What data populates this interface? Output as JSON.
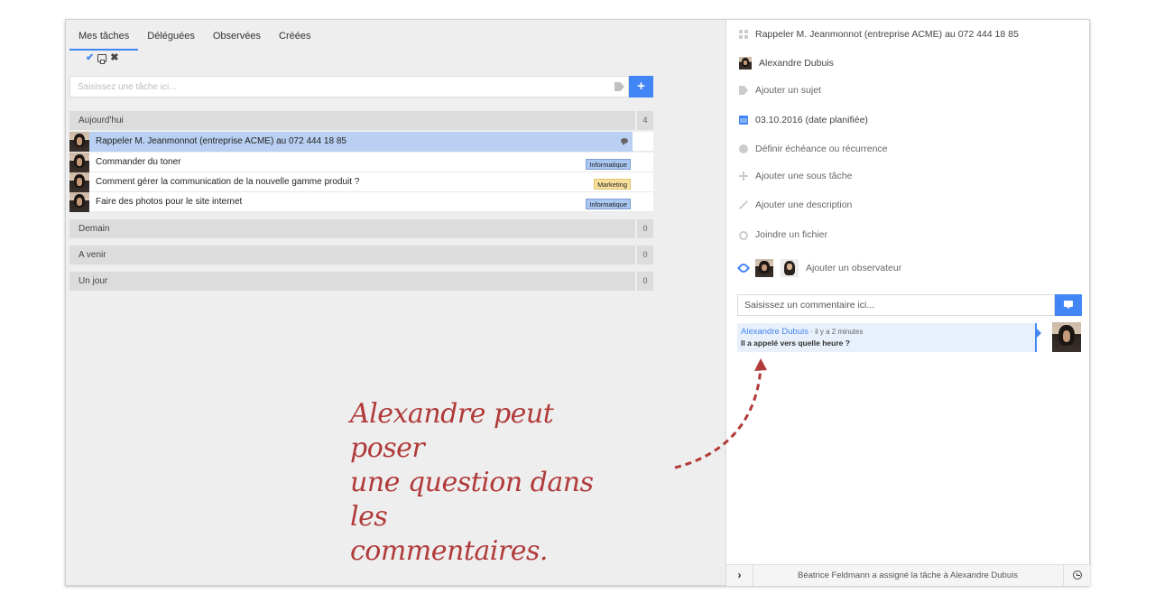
{
  "tabs": [
    "Mes tâches",
    "Déléguées",
    "Observées",
    "Créées"
  ],
  "toolbar": {
    "check_icon": "check-icon",
    "print_icon": "printer-icon",
    "close_icon": "close-icon"
  },
  "task_input": {
    "placeholder": "Saisissez une tâche ici...",
    "add_label": "+"
  },
  "sections": [
    {
      "label": "Aujourd'hui",
      "count": "4"
    },
    {
      "label": "Demain",
      "count": "0"
    },
    {
      "label": "A venir",
      "count": "0"
    },
    {
      "label": "Un jour",
      "count": "0"
    }
  ],
  "tasks": [
    {
      "title": "Rappeler M. Jeanmonnot (entreprise ACME) au 072 444 18 85",
      "priority_color": "#d0d0d0",
      "tag": "",
      "has_comment": true,
      "selected": true
    },
    {
      "title": "Commander du toner",
      "priority_color": "#dd3b2b",
      "tag": "Informatique",
      "tag_color": "#a9c7f0"
    },
    {
      "title": "Comment gérer la communication de la nouvelle gamme produit ?",
      "priority_color": "#dd3b2b",
      "tag": "Marketing",
      "tag_color": "#f9e19c"
    },
    {
      "title": "Faire des photos pour le site internet",
      "priority_color": "#4caf50",
      "tag": "Informatique",
      "tag_color": "#a9c7f0"
    }
  ],
  "annotation": {
    "lines": [
      "Alexandre peut poser",
      "une question dans les",
      "commentaires."
    ],
    "color": "#b13a3a"
  },
  "detail": {
    "title": "Rappeler M. Jeanmonnot (entreprise ACME) au 072 444 18 85",
    "assignee": "Alexandre Dubuis",
    "add_subject": "Ajouter un sujet",
    "date": "03.10.2016 (date planifiée)",
    "deadline": "Définir échéance ou récurrence",
    "add_subtask": "Ajouter une sous tâche",
    "add_description": "Ajouter une description",
    "attach_file": "Joindre un fichier",
    "add_observer": "Ajouter un observateur",
    "comment_placeholder": "Saisissez un commentaire ici...",
    "comment": {
      "author": "Alexandre Dubuis",
      "time": " · il y a 2 minutes",
      "text": "Il a appelé vers quelle heure ?"
    },
    "footer": {
      "expand": "›",
      "activity": "Béatrice Feldmann a assigné la tâche à Alexandre Dubuis"
    }
  },
  "accent_color": "#4285f4"
}
